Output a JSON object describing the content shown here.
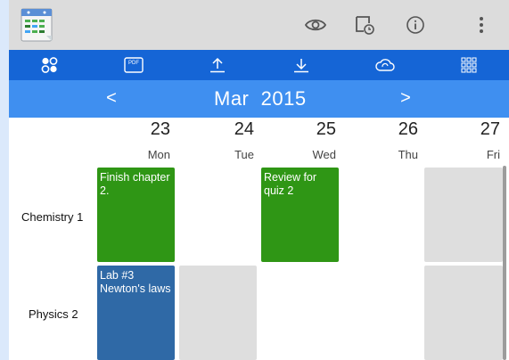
{
  "colors": {
    "appbar_bg": "#dcdcdc",
    "toolbar_bg": "#1565d6",
    "monthbar_bg": "#3f8ff0",
    "event_green": "#2f9615",
    "event_blue": "#2f69a6",
    "empty_cell": "#dedede"
  },
  "appbar": {
    "logo_icon": "timetable-app-icon",
    "actions": [
      "eye-icon",
      "schedule-display-icon",
      "info-icon",
      "overflow-menu-icon"
    ]
  },
  "toolbar": {
    "items": [
      "social-share-icon",
      "pdf-export-icon",
      "upload-icon",
      "download-icon",
      "cloud-sync-icon",
      "grid-view-icon"
    ],
    "pdf_label": "PDF"
  },
  "month_nav": {
    "prev": "<",
    "title": "Mar  2015",
    "next": ">"
  },
  "days": [
    {
      "num": "23",
      "name": "Mon"
    },
    {
      "num": "24",
      "name": "Tue"
    },
    {
      "num": "25",
      "name": "Wed"
    },
    {
      "num": "26",
      "name": "Thu"
    },
    {
      "num": "27",
      "name": "Fri"
    }
  ],
  "rows": [
    {
      "label": "Chemistry 1"
    },
    {
      "label": "Physics 2"
    }
  ],
  "events": {
    "chem_mon": "Finish chapter 2.",
    "chem_wed": "Review for quiz 2",
    "phys_mon": "Lab #3 Newton's laws"
  }
}
